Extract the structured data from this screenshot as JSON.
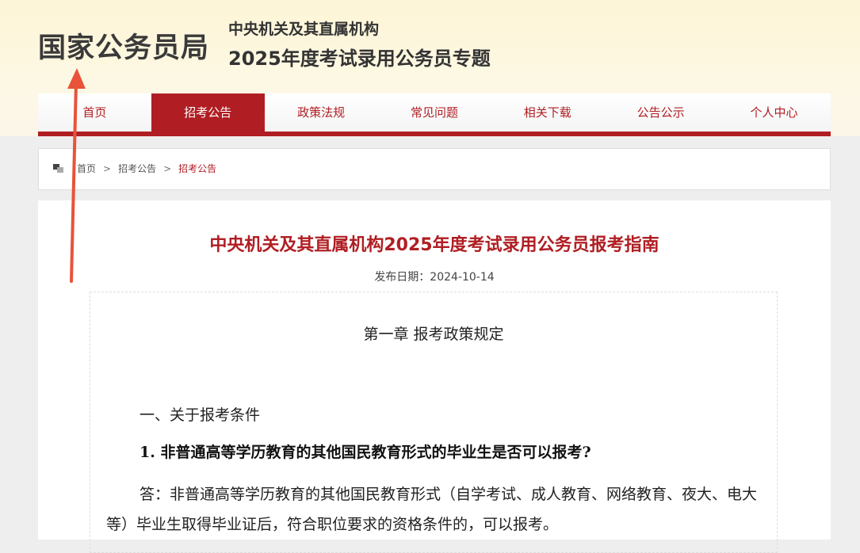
{
  "header": {
    "logo_text": "国家公务员局",
    "subtitle_line1": "中央机关及其直属机构",
    "subtitle_line2": "2025年度考试录用公务员专题"
  },
  "nav": {
    "items": [
      {
        "label": "首页"
      },
      {
        "label": "招考公告"
      },
      {
        "label": "政策法规"
      },
      {
        "label": "常见问题"
      },
      {
        "label": "相关下载"
      },
      {
        "label": "公告公示"
      },
      {
        "label": "个人中心"
      }
    ],
    "active_index": 1
  },
  "breadcrumb": {
    "items": [
      "首页",
      "招考公告",
      "招考公告"
    ],
    "separator": ">"
  },
  "article": {
    "title": "中央机关及其直属机构2025年度考试录用公务员报考指南",
    "date": "发布日期：2024-10-14",
    "chapter": "第一章  报考政策规定",
    "section": "一、关于报考条件",
    "question": "1. 非普通高等学历教育的其他国民教育形式的毕业生是否可以报考?",
    "answer": "答：非普通高等学历教育的其他国民教育形式（自学考试、成人教育、网络教育、夜大、电大等）毕业生取得毕业证后，符合职位要求的资格条件的，可以报考。"
  },
  "colors": {
    "brand_red": "#b01e23",
    "header_bg": "#fdf5d6",
    "annotation_arrow": "#e8533a"
  }
}
